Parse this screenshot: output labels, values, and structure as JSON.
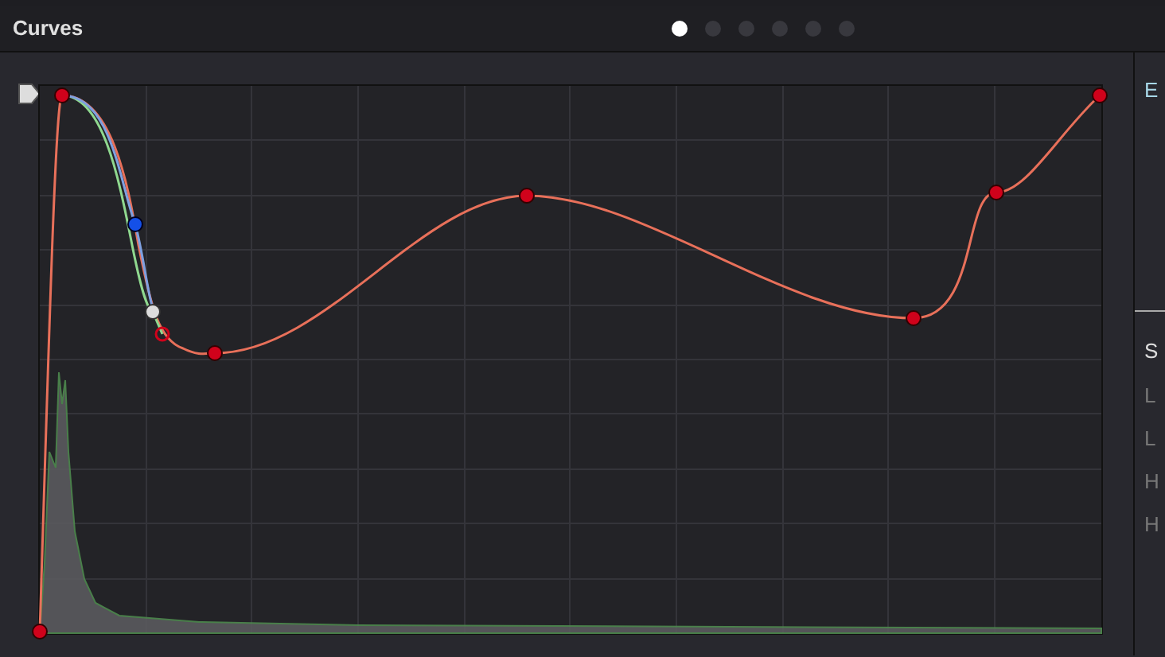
{
  "panel": {
    "title": "Curves"
  },
  "pages": [
    {
      "selected": true
    },
    {
      "selected": false
    },
    {
      "selected": false
    },
    {
      "selected": false
    },
    {
      "selected": false
    },
    {
      "selected": false
    }
  ],
  "side_panel": {
    "heading_1": "E",
    "heading_2": "S",
    "items": [
      "L",
      "L",
      "H",
      "H"
    ]
  }
}
